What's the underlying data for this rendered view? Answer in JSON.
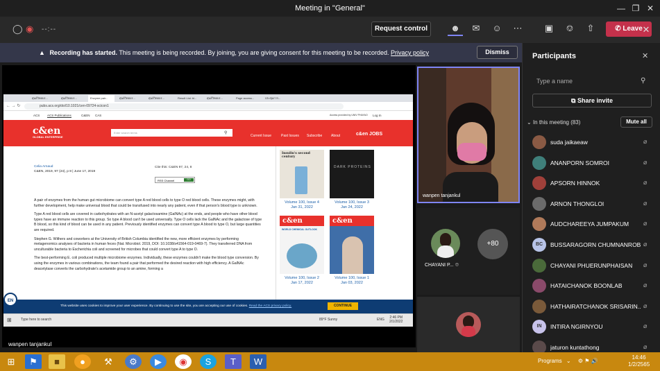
{
  "window": {
    "title": "Meeting in \"General\""
  },
  "toolbar": {
    "timer": "--:--",
    "request_control": "Request control",
    "leave": "Leave"
  },
  "banner": {
    "strong": "Recording has started.",
    "text": "This meeting is being recorded. By joining, you are giving consent for this meeting to be recorded.",
    "link": "Privacy policy",
    "dismiss": "Dismiss"
  },
  "shared_screen": {
    "presenter_name": "wanpen tanjankul",
    "tabs": [
      "ศุนย์วิทยบร...",
      "ศุนย์วิทยบร...",
      "Enzyme pair...",
      "ศุนย์วิทยบร...",
      "ศุนย์วิทยบร...",
      "Result List: bl...",
      "ศุนย์วิทยบร...",
      "Page access...",
      "ประชุมการ..."
    ],
    "url": "pubs.acs.org/doi/10.1021/cen-09724-scicon1",
    "acs_bar": [
      "ACS",
      "ACS Publications",
      "C&EN",
      "CAS"
    ],
    "acs_bar_right": "Access provided by UNIV PHAYAO",
    "log_in": "Log In",
    "logo": "c&en",
    "logo_sub": "GLOBAL ENTERPRISE",
    "search_placeholder": "Enter search terms",
    "nav": [
      "Current Issue",
      "Past Issues",
      "Subscribe",
      "About"
    ],
    "jobs": "c&en JOBS",
    "byline": {
      "author": "Celia Arnaud",
      "cite": "C&EN, 2019, 97 (24), p 8 | June 17, 2019",
      "cite_this": "Cite this: C&EN 97, 24, 8",
      "rss": "RSS Channel",
      "go": "GO"
    },
    "paragraphs": [
      "A pair of enzymes from the human gut microbiome can convert type A red blood cells to type O red blood cells. These enzymes might, with further development, help make universal blood that could be transfused into nearly any patient, even if that person's blood type is unknown.",
      "Type A red blood cells are covered in carbohydrates with an N-acetyl galactosamine (GalNAc) at the ends, and people who have other blood types have an immune reaction to this group. So type A blood can't be used universally. Type O cells lack the GalNAc and the galactose of type B blood, so this kind of blood can be used in any patient. Previously identified enzymes can convert type A blood to type O, but large quantities are required.",
      "Stephen G. Withers and coworkers at the University of British Columbia identified the new, more efficient enzymes by performing metagenomics analyses of bacteria in human feces (Nat. Microbiol. 2019, DOI: 10.1038/s41564-019-0469-7). They transferred DNA from unculturable bacteria to Escherichia coli and screened for microbes that could convert type A to type O.",
      "The best-performing E. coli produced multiple microbiome enzymes. Individually, these enzymes couldn't make the blood type conversion. By using the enzymes in various combinations, the team found a pair that performed the desired reaction with high efficiency. A GalNAc deacetylase converts the carbohydrate's acetamide group to an amine, forming a"
    ],
    "covers": [
      {
        "label": "Volume 100, Issue 4",
        "date": "Jan 31, 2022"
      },
      {
        "label": "Volume 100, Issue 3",
        "date": "Jan 24, 2022"
      },
      {
        "label": "Volume 100, Issue 2",
        "date": "Jan 17, 2022"
      },
      {
        "label": "Volume 100, Issue 1",
        "date": "Jan 03, 2022"
      }
    ],
    "cover_text": [
      "Insulin's second century",
      "DARK PROTEINS",
      "WORLD CHEMICAL OUTLOOK",
      "c&en"
    ],
    "cookie_text": "This website uses cookies to improve your user experience. By continuing to use the site, you are accepting our use of cookies.",
    "cookie_link": "Read the ACS privacy policy.",
    "continue": "CONTINUE",
    "en_badge": "EN",
    "win_search": "Type here to search",
    "win_weather": "89°F Sunny",
    "win_time": "2:46 PM",
    "win_date": "2/1/2022",
    "win_lang": "ENG"
  },
  "videos": {
    "main_name": "wanpen tanjankul",
    "small_name": "CHAYANI P...",
    "overflow": "+80"
  },
  "participants": {
    "title": "Participants",
    "search_placeholder": "Type a name",
    "share_invite": "Share invite",
    "in_meeting": "In this meeting (83)",
    "mute_all": "Mute all",
    "list": [
      {
        "name": "suda jaikaeaw",
        "initials": "",
        "color": "#8a5a44"
      },
      {
        "name": "ANANPORN SOMROI",
        "initials": "",
        "color": "#3f7f7a"
      },
      {
        "name": "APSORN HINNOK",
        "initials": "",
        "color": "#a0403a"
      },
      {
        "name": "ARNON THONGLOI",
        "initials": "",
        "color": "#6b6b6b"
      },
      {
        "name": "AUDCHAREEYA JUMPAKUM",
        "initials": "",
        "color": "#b07a5a"
      },
      {
        "name": "BUSSARAGORN CHUMNANROB",
        "initials": "BC",
        "color": "#b8c4e8"
      },
      {
        "name": "CHAYANI PHUERUNPHAISAN",
        "initials": "",
        "color": "#4a6a3a"
      },
      {
        "name": "HATAICHANOK BOONLAB",
        "initials": "",
        "color": "#8a4a6a"
      },
      {
        "name": "HATHAIRATCHANOK SRISARIN...",
        "initials": "",
        "color": "#7a5a3a"
      },
      {
        "name": "INTIRA NGIRNYOU",
        "initials": "IN",
        "color": "#c7c2ea"
      },
      {
        "name": "jaturon kuntathong",
        "initials": "",
        "color": "#5a4a4a"
      }
    ]
  },
  "taskbar": {
    "programs": "Programs",
    "time": "14:46",
    "date": "1/2/2565"
  }
}
